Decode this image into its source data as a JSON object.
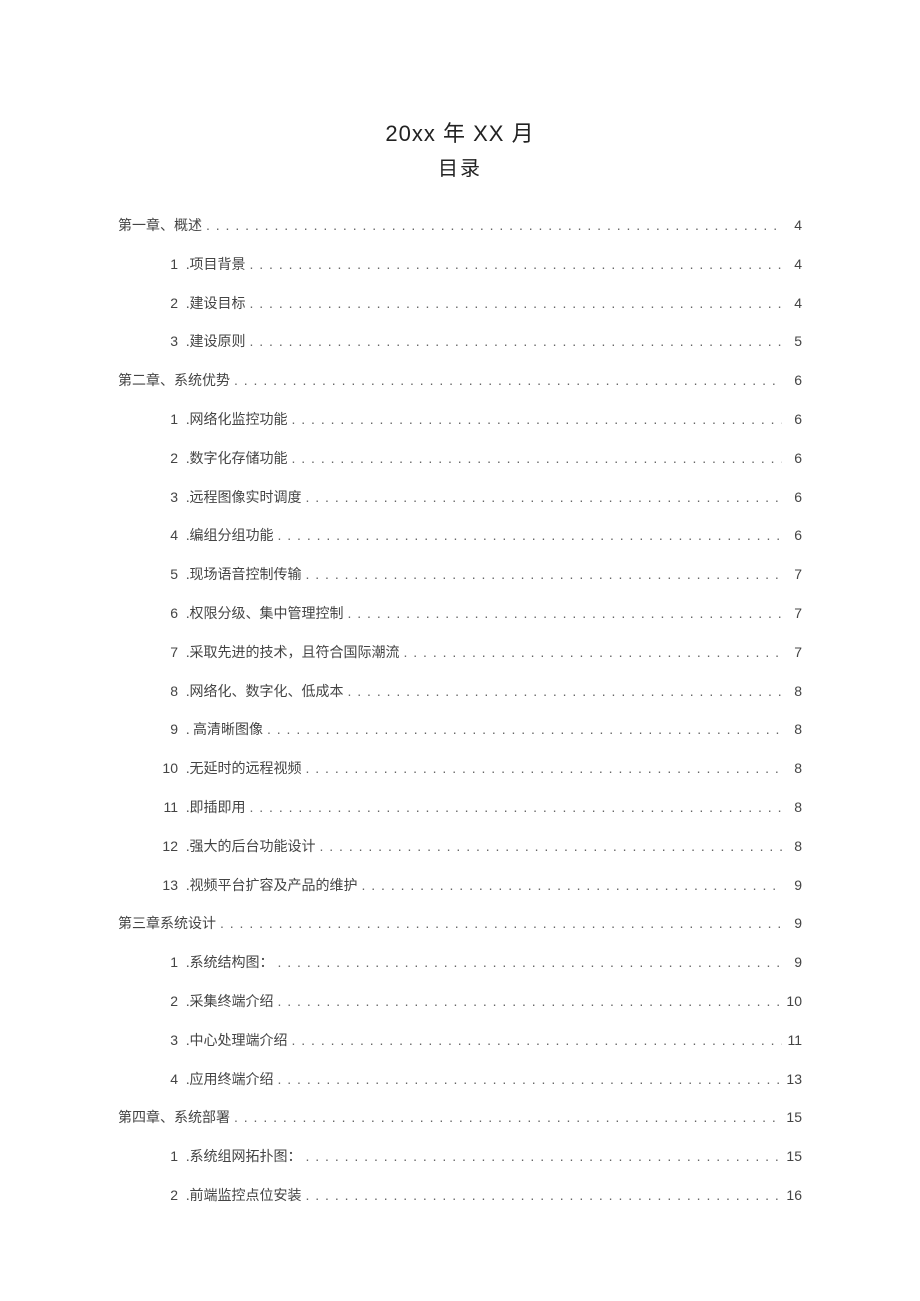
{
  "header": {
    "line1": "20xx 年 XX 月",
    "line2": "目录"
  },
  "toc": [
    {
      "type": "chapter",
      "label": "第一章、概述",
      "page": "4"
    },
    {
      "type": "item",
      "num": "1",
      "label": ".项目背景",
      "page": "4"
    },
    {
      "type": "item",
      "num": "2",
      "label": ".建设目标",
      "page": "4"
    },
    {
      "type": "item",
      "num": "3",
      "label": ".建设原则",
      "page": "5"
    },
    {
      "type": "chapter",
      "label": "第二章、系统优势",
      "page": "6"
    },
    {
      "type": "item",
      "num": "1",
      "label": ".网络化监控功能",
      "page": "6"
    },
    {
      "type": "item",
      "num": "2",
      "label": ".数字化存储功能",
      "page": "6"
    },
    {
      "type": "item",
      "num": "3",
      "label": ".远程图像实时调度",
      "page": "6"
    },
    {
      "type": "item",
      "num": "4",
      "label": ".编组分组功能",
      "page": "6"
    },
    {
      "type": "item",
      "num": "5",
      "label": ".现场语音控制传输",
      "page": "7"
    },
    {
      "type": "item",
      "num": "6",
      "label": ".权限分级、集中管理控制",
      "page": "7"
    },
    {
      "type": "item",
      "num": "7",
      "label": ".采取先进的技术，且符合国际潮流",
      "page": "7"
    },
    {
      "type": "item",
      "num": "8",
      "label": ".网络化、数字化、低成本",
      "page": "8"
    },
    {
      "type": "item",
      "num": "9",
      "label": ". 高清晰图像",
      "page": "8"
    },
    {
      "type": "item",
      "num": "10",
      "label": ".无延时的远程视频",
      "page": "8"
    },
    {
      "type": "item",
      "num": "11",
      "label": ".即插即用",
      "page": "8"
    },
    {
      "type": "item",
      "num": "12",
      "label": ".强大的后台功能设计",
      "page": "8"
    },
    {
      "type": "item",
      "num": "13",
      "label": ".视频平台扩容及产品的维护",
      "page": "9"
    },
    {
      "type": "chapter",
      "label": "第三章系统设计",
      "page": "9"
    },
    {
      "type": "item",
      "num": "1",
      "label": ".系统结构图：",
      "page": "9"
    },
    {
      "type": "item",
      "num": "2",
      "label": ".采集终端介绍",
      "page": "10"
    },
    {
      "type": "item",
      "num": "3",
      "label": ".中心处理端介绍",
      "page": "11"
    },
    {
      "type": "item",
      "num": "4",
      "label": ".应用终端介绍",
      "page": "13"
    },
    {
      "type": "chapter",
      "label": "第四章、系统部署",
      "page": "15"
    },
    {
      "type": "item",
      "num": "1",
      "label": ".系统组网拓扑图：",
      "page": "15"
    },
    {
      "type": "item",
      "num": "2",
      "label": ".前端监控点位安装",
      "page": "16"
    }
  ]
}
